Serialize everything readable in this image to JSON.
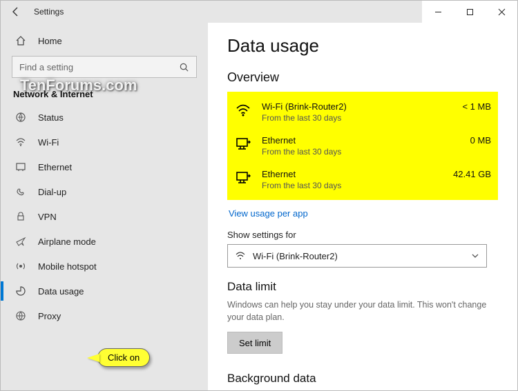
{
  "window": {
    "title": "Settings"
  },
  "sidebar": {
    "home": "Home",
    "search_placeholder": "Find a setting",
    "category": "Network & Internet",
    "items": [
      {
        "label": "Status"
      },
      {
        "label": "Wi-Fi"
      },
      {
        "label": "Ethernet"
      },
      {
        "label": "Dial-up"
      },
      {
        "label": "VPN"
      },
      {
        "label": "Airplane mode"
      },
      {
        "label": "Mobile hotspot"
      },
      {
        "label": "Data usage"
      },
      {
        "label": "Proxy"
      }
    ]
  },
  "page": {
    "title": "Data usage",
    "overview_heading": "Overview",
    "items": [
      {
        "name": "Wi-Fi (Brink-Router2)",
        "sub": "From the last 30 days",
        "value": "< 1 MB",
        "icon": "wifi"
      },
      {
        "name": "Ethernet",
        "sub": "From the last 30 days",
        "value": "0 MB",
        "icon": "ethernet"
      },
      {
        "name": "Ethernet",
        "sub": "From the last 30 days",
        "value": "42.41 GB",
        "icon": "ethernet"
      }
    ],
    "view_link": "View usage per app",
    "show_label": "Show settings for",
    "show_value": "Wi-Fi (Brink-Router2)",
    "limit_heading": "Data limit",
    "limit_desc": "Windows can help you stay under your data limit. This won't change your data plan.",
    "set_limit": "Set limit",
    "bg_heading": "Background data"
  },
  "annotation": {
    "watermark": "TenForums.com",
    "callout": "Click on"
  }
}
